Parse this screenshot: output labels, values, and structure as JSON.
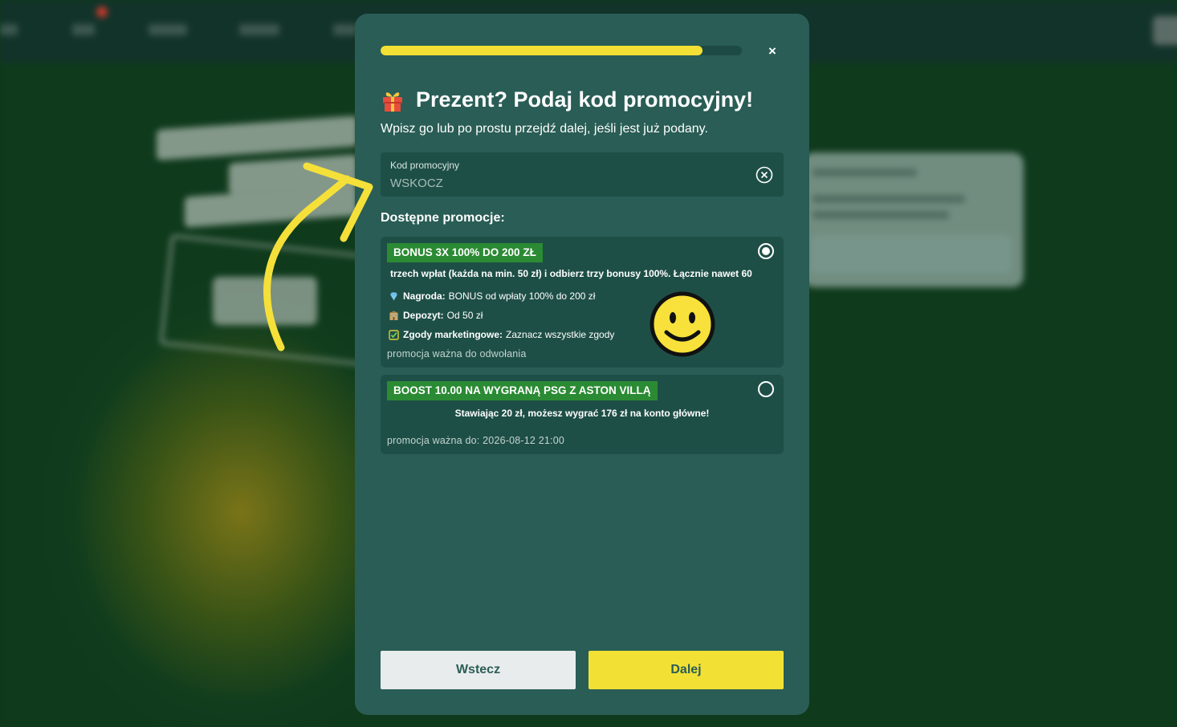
{
  "modal": {
    "progress_percent": 89,
    "close_label": "×",
    "title": "Prezent? Podaj kod promocyjny!",
    "subtitle": "Wpisz go lub po prostu przejdź dalej, jeśli jest już podany.",
    "code_field": {
      "label": "Kod promocyjny",
      "value": "WSKOCZ"
    },
    "section_title": "Dostępne promocje:",
    "promotions": [
      {
        "tag": "BONUS 3X 100% DO 200 ZŁ",
        "selected": true,
        "description": "trzech wpłat (każda na min. 50 zł) i odbierz trzy bonusy 100%. Łącznie nawet 60",
        "details": [
          {
            "icon": "diamond-icon",
            "label": "Nagroda:",
            "value": "BONUS od wpłaty 100% do 200 zł"
          },
          {
            "icon": "bank-icon",
            "label": "Depozyt:",
            "value": "Od 50 zł"
          },
          {
            "icon": "checkbox-icon",
            "label": "Zgody marketingowe:",
            "value": "Zaznacz wszystkie zgody"
          }
        ],
        "validity": "promocja ważna do odwołania"
      },
      {
        "tag": "BOOST 10.00 NA WYGRANĄ PSG Z ASTON VILLĄ",
        "selected": false,
        "description": "Stawiając 20 zł, możesz wygrać 176 zł na konto główne!",
        "validity": "promocja ważna do: 2026-08-12 21:00"
      }
    ],
    "buttons": {
      "back": "Wstecz",
      "next": "Dalej"
    }
  },
  "colors": {
    "modal_bg": "#295d55",
    "field_bg": "#1e4f47",
    "accent_yellow": "#f2e034",
    "tag_green": "#2b8a34",
    "page_bg": "#0f3a1c"
  }
}
